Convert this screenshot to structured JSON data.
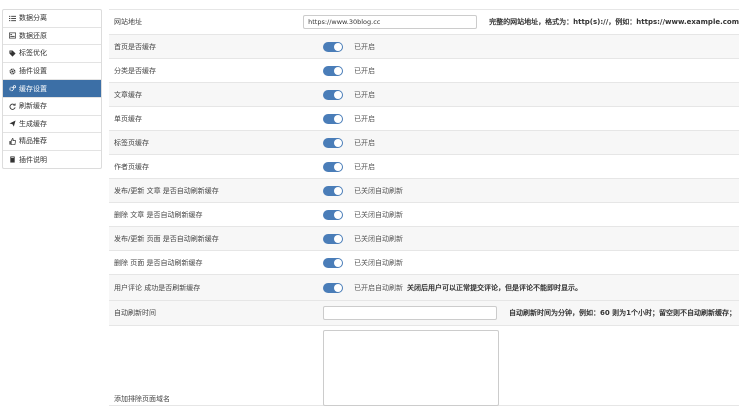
{
  "sidebar": {
    "items": [
      {
        "label": "数据分离",
        "icon": "list-icon"
      },
      {
        "label": "数据还原",
        "icon": "restore-icon"
      },
      {
        "label": "标签优化",
        "icon": "tag-icon"
      },
      {
        "label": "插件设置",
        "icon": "gear-icon"
      },
      {
        "label": "缓存设置",
        "icon": "cogs-icon",
        "active": true
      },
      {
        "label": "刷新缓存",
        "icon": "refresh-icon"
      },
      {
        "label": "生成缓存",
        "icon": "paper-plane-icon"
      },
      {
        "label": "精品推荐",
        "icon": "thumbs-up-icon"
      },
      {
        "label": "插件说明",
        "icon": "book-icon"
      }
    ]
  },
  "form": {
    "site_url": {
      "label": "网站地址",
      "value": "https://www.30blog.cc",
      "hint": "完整的网站地址，格式为：http(s)://，例如：https://www.example.com"
    },
    "toggles": [
      {
        "label": "首页是否缓存",
        "state": "已开启"
      },
      {
        "label": "分类是否缓存",
        "state": "已开启"
      },
      {
        "label": "文章缓存",
        "state": "已开启"
      },
      {
        "label": "单页缓存",
        "state": "已开启"
      },
      {
        "label": "标签页缓存",
        "state": "已开启"
      },
      {
        "label": "作者页缓存",
        "state": "已开启"
      },
      {
        "label": "发布/更新 文章 是否自动刷新缓存",
        "state": "已关闭自动刷新"
      },
      {
        "label": "删除 文章 是否自动刷新缓存",
        "state": "已关闭自动刷新"
      },
      {
        "label": "发布/更新 页面 是否自动刷新缓存",
        "state": "已关闭自动刷新"
      },
      {
        "label": "删除 页面 是否自动刷新缓存",
        "state": "已关闭自动刷新"
      },
      {
        "label": "用户评论 成功是否刷新缓存",
        "state": "已开启自动刷新",
        "hint": "关闭后用户可以正常提交评论，但是评论不能即时显示。"
      }
    ],
    "refresh_time": {
      "label": "自动刷新时间",
      "value": "",
      "hint": "自动刷新时间为分钟，例如：60 则为1个小时；留空则不自动刷新缓存；"
    },
    "exclude": {
      "label": "添加排除页面域名"
    }
  },
  "colors": {
    "accent": "#3c6fa6",
    "toggle_on": "#4a7db8"
  }
}
